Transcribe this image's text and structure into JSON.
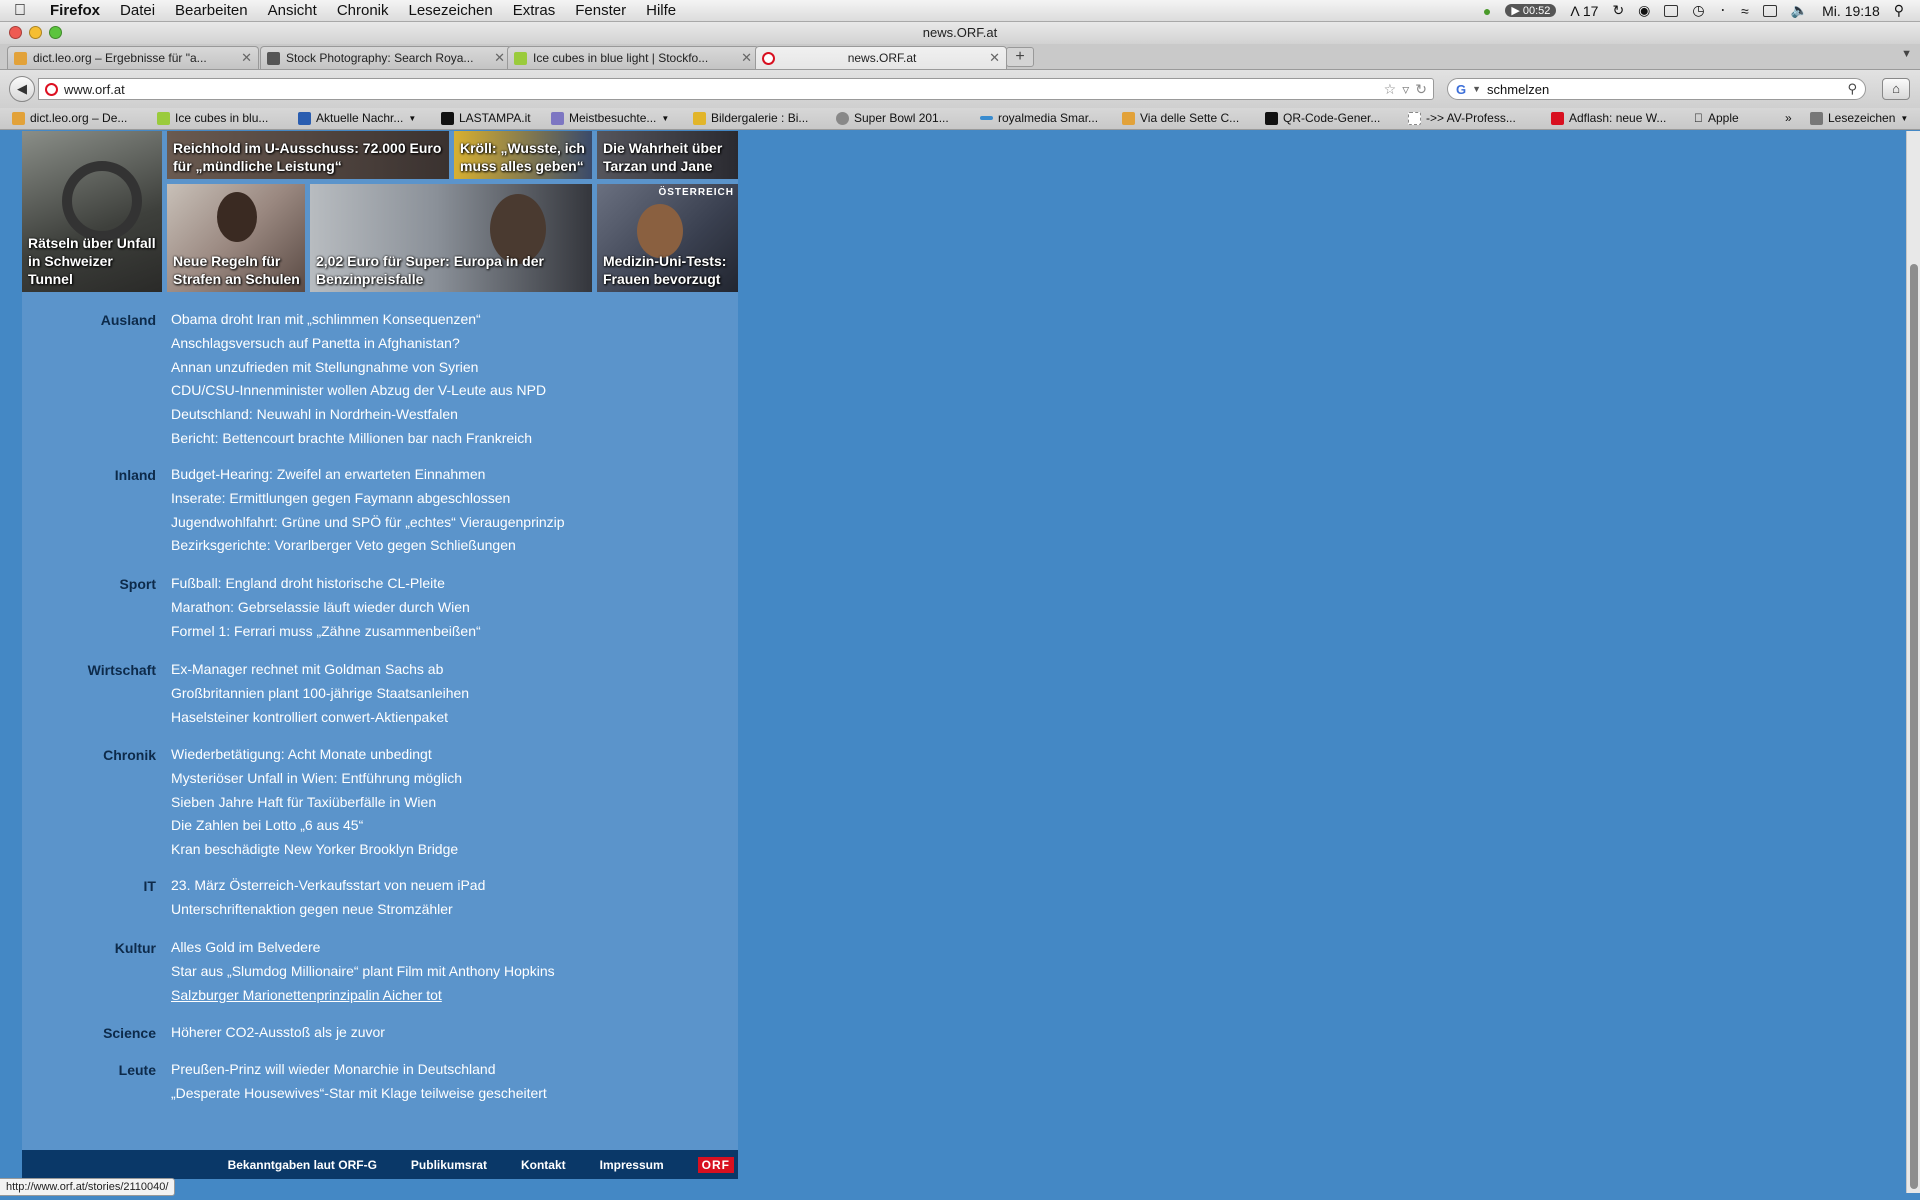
{
  "menubar": {
    "apple": "",
    "app": "Firefox",
    "items": [
      "Datei",
      "Bearbeiten",
      "Ansicht",
      "Chronik",
      "Lesezeichen",
      "Extras",
      "Fenster",
      "Hilfe"
    ],
    "timer": "00:52",
    "adobe": "17",
    "clock": "Mi. 19:18"
  },
  "window": {
    "title": "news.ORF.at"
  },
  "tabs": [
    {
      "label": "dict.leo.org – Ergebnisse für \"a...",
      "color": "#e2a23a"
    },
    {
      "label": "Stock Photography: Search Roya...",
      "color": "#555555"
    },
    {
      "label": "Ice cubes in blue light | Stockfo...",
      "color": "#9acb3c"
    },
    {
      "label": "news.ORF.at",
      "color": "#d81020"
    }
  ],
  "nav": {
    "url": "www.orf.at",
    "search_value": "schmelzen",
    "search_engine": "G"
  },
  "bookmarks": [
    {
      "label": "dict.leo.org – De...",
      "color": "#e2a23a"
    },
    {
      "label": "Ice cubes in blu...",
      "color": "#9acb3c"
    },
    {
      "label": "Aktuelle Nachr...",
      "color": "#2a5db0"
    },
    {
      "label": "LASTAMPA.it",
      "color": "#111111"
    },
    {
      "label": "Meistbesuchte...",
      "color": "#7d76c2"
    },
    {
      "label": "Bildergalerie : Bi...",
      "color": "#e2b52a"
    },
    {
      "label": "Super Bowl 201...",
      "color": "#888888"
    },
    {
      "label": "royalmedia Smar...",
      "color": "#3a8ccf"
    },
    {
      "label": "Via delle Sette C...",
      "color": "#e2a23a"
    },
    {
      "label": "QR-Code-Gener...",
      "color": "#111111"
    },
    {
      "label": "->> AV-Profess...",
      "color": "#cccccc"
    },
    {
      "label": "Adflash: neue W...",
      "color": "#d81020"
    },
    {
      "label": "Apple",
      "color": "#444444"
    },
    {
      "label": "Lesezeichen",
      "color": "#777777"
    }
  ],
  "photos": [
    {
      "caption": "Rätseln über Unfall in Schweizer Tunnel",
      "bg": "#5a5a58"
    },
    {
      "caption": "Reichhold im U-Ausschuss: 72.000 Euro für „mündliche Leistung“",
      "bg": "#4a4240"
    },
    {
      "caption": "Kröll: „Wusste, ich muss alles geben“",
      "bg": "#c09a28"
    },
    {
      "caption": "Die Wahrheit über Tarzan und Jane",
      "bg": "#3a3a40"
    },
    {
      "caption": "Neue Regeln für Strafen an Schulen",
      "bg": "#8a7a70"
    },
    {
      "caption": "2,02 Euro für Super: Europa in der Benzinpreisfalle",
      "bg": "#707478"
    },
    {
      "caption": "Medizin-Uni-Tests: Frauen bevorzugt",
      "bg": "#4a5060",
      "flag": "ÖSTERREICH"
    }
  ],
  "sections": [
    {
      "name": "Ausland",
      "items": [
        "Obama droht Iran mit „schlimmen Konsequenzen“",
        "Anschlagsversuch auf Panetta in Afghanistan?",
        "Annan unzufrieden mit Stellungnahme von Syrien",
        "CDU/CSU-Innenminister wollen Abzug der V-Leute aus NPD",
        "Deutschland: Neuwahl in Nordrhein-Westfalen",
        "Bericht: Bettencourt brachte Millionen bar nach Frankreich"
      ]
    },
    {
      "name": "Inland",
      "items": [
        "Budget-Hearing: Zweifel an erwarteten Einnahmen",
        "Inserate: Ermittlungen gegen Faymann abgeschlossen",
        "Jugendwohlfahrt: Grüne und SPÖ für „echtes“ Vieraugenprinzip",
        "Bezirksgerichte: Vorarlberger Veto gegen Schließungen"
      ]
    },
    {
      "name": "Sport",
      "items": [
        "Fußball: England droht historische CL-Pleite",
        "Marathon: Gebrselassie läuft wieder durch Wien",
        "Formel 1: Ferrari muss „Zähne zusammenbeißen“"
      ]
    },
    {
      "name": "Wirtschaft",
      "items": [
        "Ex-Manager rechnet mit Goldman Sachs ab",
        "Großbritannien plant 100-jährige Staatsanleihen",
        "Haselsteiner kontrolliert conwert-Aktienpaket"
      ]
    },
    {
      "name": "Chronik",
      "items": [
        "Wiederbetätigung: Acht Monate unbedingt",
        "Mysteriöser Unfall in Wien: Entführung möglich",
        "Sieben Jahre Haft für Taxiüberfälle in Wien",
        "Die Zahlen bei Lotto „6 aus 45“",
        "Kran beschädigte New Yorker Brooklyn Bridge"
      ]
    },
    {
      "name": "IT",
      "items": [
        "23. März Österreich-Verkaufsstart von neuem iPad",
        "Unterschriftenaktion gegen neue Stromzähler"
      ]
    },
    {
      "name": "Kultur",
      "items": [
        "Alles Gold im Belvedere",
        "Star aus „Slumdog Millionaire“ plant Film mit Anthony Hopkins",
        "Salzburger Marionettenprinzipalin Aicher tot"
      ],
      "hovered": 2
    },
    {
      "name": "Science",
      "items": [
        "Höherer CO2-Ausstoß als je zuvor"
      ]
    },
    {
      "name": "Leute",
      "items": [
        "Preußen-Prinz will wieder Monarchie in Deutschland",
        "„Desperate Housewives“-Star mit Klage teilweise gescheitert"
      ]
    }
  ],
  "footer": {
    "links": [
      "Bekanntgaben laut ORF-G",
      "Publikumsrat",
      "Kontakt",
      "Impressum"
    ],
    "logo": "ORF"
  },
  "status": "http://www.orf.at/stories/2110040/",
  "colors": {
    "page_bg": "#4488c5",
    "content_bg": "#5b94cb",
    "footer_bg": "#0a3868",
    "brand": "#d81020"
  }
}
